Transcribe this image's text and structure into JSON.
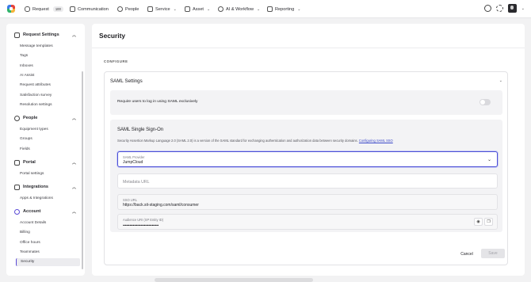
{
  "nav": {
    "items": [
      {
        "label": "Request",
        "icon": "inbox-icon",
        "badge": "100"
      },
      {
        "label": "Communication",
        "icon": "megaphone-icon"
      },
      {
        "label": "People",
        "icon": "person-icon"
      },
      {
        "label": "Service",
        "icon": "stack-icon",
        "has_chevron": true
      },
      {
        "label": "Asset",
        "icon": "asset-icon",
        "has_chevron": true
      },
      {
        "label": "AI & Workflow",
        "icon": "wand-icon",
        "has_chevron": true
      },
      {
        "label": "Reporting",
        "icon": "chart-icon",
        "has_chevron": true
      }
    ],
    "right_icons": [
      "search-icon",
      "gear-icon",
      "avatar"
    ]
  },
  "sidebar": {
    "sections": [
      {
        "title": "Request Settings",
        "icon": "inbox-icon",
        "items": [
          "Message templates",
          "Tags",
          "Inboxes",
          "AI Assist",
          "Request attributes",
          "Satisfaction survey",
          "Resolution settings"
        ]
      },
      {
        "title": "People",
        "icon": "person-icon",
        "items": [
          "Equipment types",
          "Groups",
          "Fields"
        ]
      },
      {
        "title": "Portal",
        "icon": "home-icon",
        "items": [
          "Portal settings"
        ]
      },
      {
        "title": "Integrations",
        "icon": "grid-icon",
        "items": [
          "Apps & Integrations"
        ]
      },
      {
        "title": "Account",
        "icon": "gear-icon",
        "items": [
          "Account Details",
          "Billing",
          "Office hours",
          "Teammates",
          "Security"
        ]
      }
    ],
    "active_item": "Security"
  },
  "main": {
    "title": "Security",
    "section_label": "CONFIGURE",
    "card": {
      "title": "SAML Settings",
      "require_saml_label": "Require users to log in using SAML exclusively",
      "require_saml_enabled": false,
      "sso": {
        "title": "SAML Single Sign-On",
        "description": "Security Assertion Markup Language 2.0 (SAML 2.0) is a version of the SAML standard for exchanging authentication and authorization data between security domains.",
        "link_text": "Configuring SAML SSO",
        "provider_label": "SAML Provider",
        "provider_value": "JumpCloud",
        "metadata_placeholder": "Metadata URL",
        "sso_url_label": "SSO URL",
        "sso_url_value": "https://back.sit-staging.com/saml/consumer",
        "audience_label": "Audience URI (SP Entity ID)",
        "audience_value": "••••••••••••••••••••••••••••••••"
      },
      "cancel_label": "Cancel",
      "save_label": "Save"
    }
  },
  "colors": {
    "accent": "#5b4bd6",
    "link": "#3b48c8",
    "focus": "#4b4fd6"
  }
}
